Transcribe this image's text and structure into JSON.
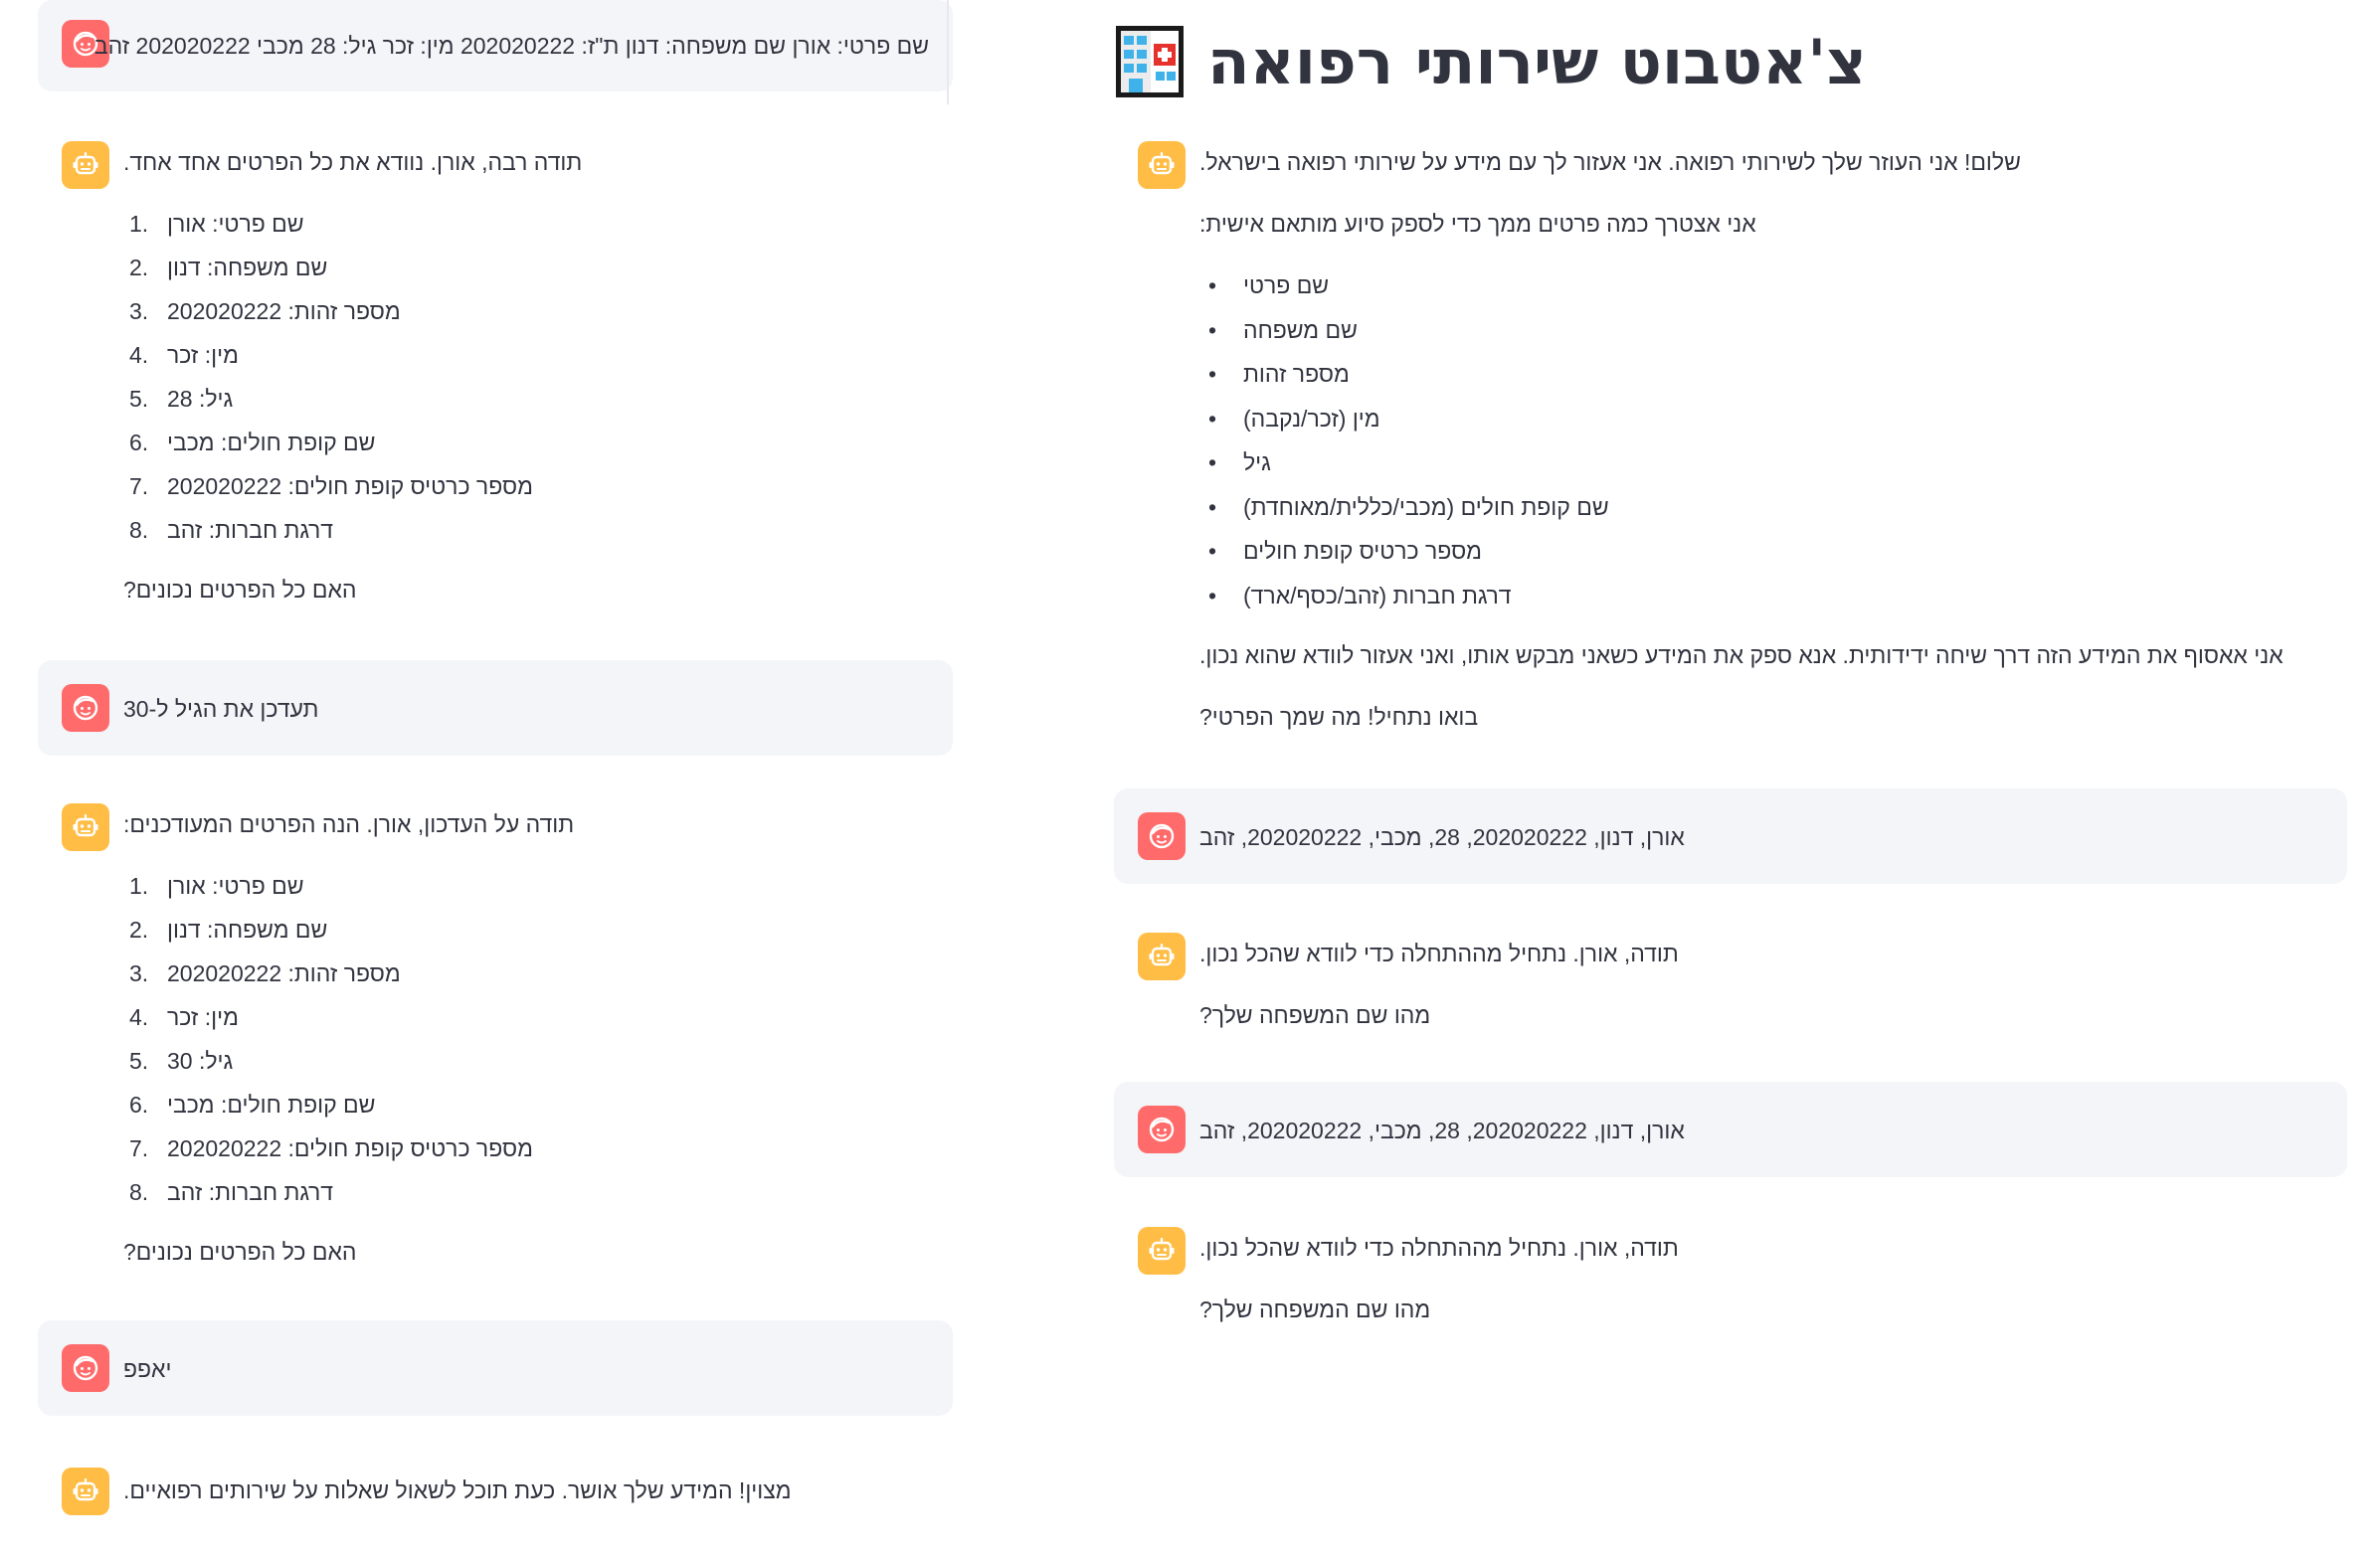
{
  "app": {
    "title": "צ'אטבוט שירותי רפואה",
    "icon": "hospital-icon",
    "colors": {
      "user_avatar": "#ff6b6b",
      "bot_avatar": "#ffbd45",
      "user_bubble": "#f4f5f8",
      "text": "#31333f"
    }
  },
  "right": {
    "greeting": {
      "line1": "שלום! אני העוזר שלך לשירותי רפואה. אני אעזור לך עם מידע על שירותי רפואה בישראל.",
      "line2": "אני אצטרך כמה פרטים ממך כדי לספק סיוע מותאם אישית:",
      "items": [
        "שם פרטי",
        "שם משפחה",
        "מספר זהות",
        "מין (זכר/נקבה)",
        "גיל",
        "שם קופת חולים (מכבי/כללית/מאוחדת)",
        "מספר כרטיס קופת חולים",
        "דרגת חברות (זהב/כסף/ארד)"
      ],
      "line3": "אני אאסוף את המידע הזה דרך שיחה ידידותית. אנא ספק את המידע כשאני מבקש אותו, ואני אעזור לוודא שהוא נכון.",
      "line4": "בואו נתחיל! מה שמך הפרטי?"
    },
    "user1": "אורן, דנון, 202020222, 28, מכבי, 202020222, זהב",
    "bot1": {
      "line1": "תודה, אורן. נתחיל מההתחלה כדי לוודא שהכל נכון.",
      "line2": "מהו שם המשפחה שלך?"
    },
    "user2": "אורן, דנון, 202020222, 28, מכבי, 202020222, זהב",
    "bot2": {
      "line1": "תודה, אורן. נתחיל מההתחלה כדי לוודא שהכל נכון.",
      "line2": "מהו שם המשפחה שלך?"
    }
  },
  "left": {
    "user1": "שם פרטי: אורן שם משפחה: דנון ת\"ז: 202020222 מין: זכר גיל: 28 מכבי 202020222 זהב",
    "bot1": {
      "intro": "תודה רבה, אורן. נוודא את כל הפרטים אחד אחד.",
      "items": [
        "שם פרטי: אורן",
        "שם משפחה: דנון",
        "מספר זהות: 202020222",
        "מין: זכר",
        "גיל: 28",
        "שם קופת חולים: מכבי",
        "מספר כרטיס קופת חולים: 202020222",
        "דרגת חברות: זהב"
      ],
      "question": "האם כל הפרטים נכונים?"
    },
    "user2": "תעדכן את הגיל ל-30",
    "bot2": {
      "intro": "תודה על העדכון, אורן. הנה הפרטים המעודכנים:",
      "items": [
        "שם פרטי: אורן",
        "שם משפחה: דנון",
        "מספר זהות: 202020222",
        "מין: זכר",
        "גיל: 30",
        "שם קופת חולים: מכבי",
        "מספר כרטיס קופת חולים: 202020222",
        "דרגת חברות: זהב"
      ],
      "question": "האם כל הפרטים נכונים?"
    },
    "user3": "יאפפ",
    "bot3": "מצוין! המידע שלך אושר. כעת תוכל לשאול שאלות על שירותים רפואיים."
  }
}
